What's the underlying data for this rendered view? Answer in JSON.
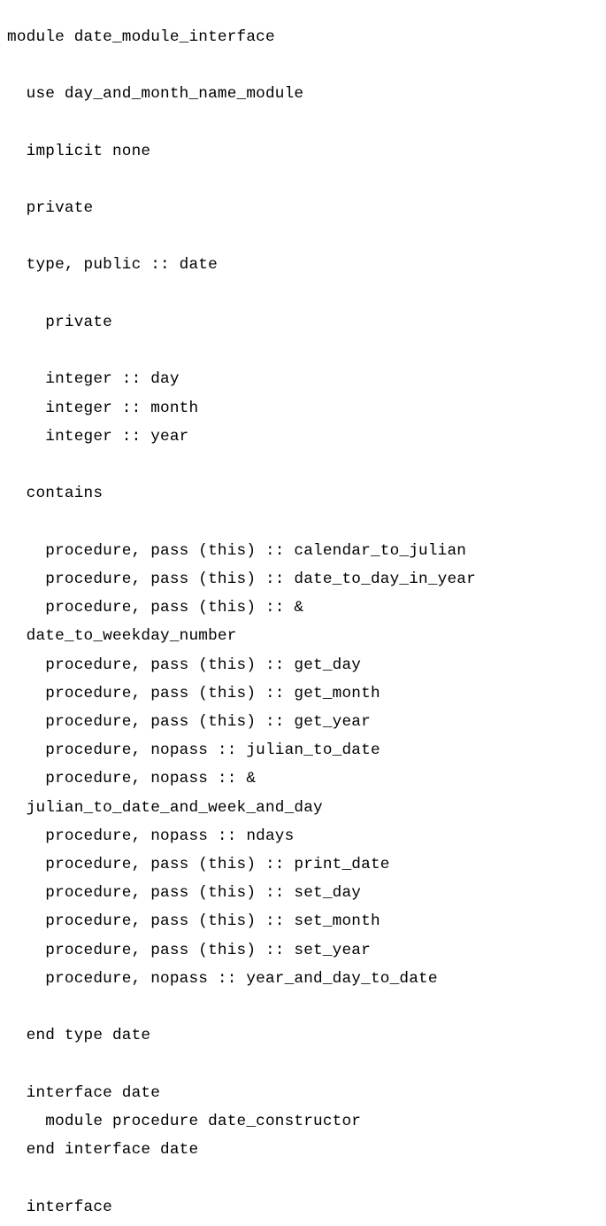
{
  "code": {
    "lines": [
      "module date_module_interface",
      "",
      "  use day_and_month_name_module",
      "",
      "  implicit none",
      "",
      "  private",
      "",
      "  type, public :: date",
      "",
      "    private",
      "",
      "    integer :: day",
      "    integer :: month",
      "    integer :: year",
      "",
      "  contains",
      "",
      "    procedure, pass (this) :: calendar_to_julian",
      "    procedure, pass (this) :: date_to_day_in_year",
      "    procedure, pass (this) :: &",
      "  date_to_weekday_number",
      "    procedure, pass (this) :: get_day",
      "    procedure, pass (this) :: get_month",
      "    procedure, pass (this) :: get_year",
      "    procedure, nopass :: julian_to_date",
      "    procedure, nopass :: &",
      "  julian_to_date_and_week_and_day",
      "    procedure, nopass :: ndays",
      "    procedure, pass (this) :: print_date",
      "    procedure, pass (this) :: set_day",
      "    procedure, pass (this) :: set_month",
      "    procedure, pass (this) :: set_year",
      "    procedure, nopass :: year_and_day_to_date",
      "",
      "  end type date",
      "",
      "  interface date",
      "    module procedure date_constructor",
      "  end interface date",
      "",
      "  interface"
    ]
  }
}
